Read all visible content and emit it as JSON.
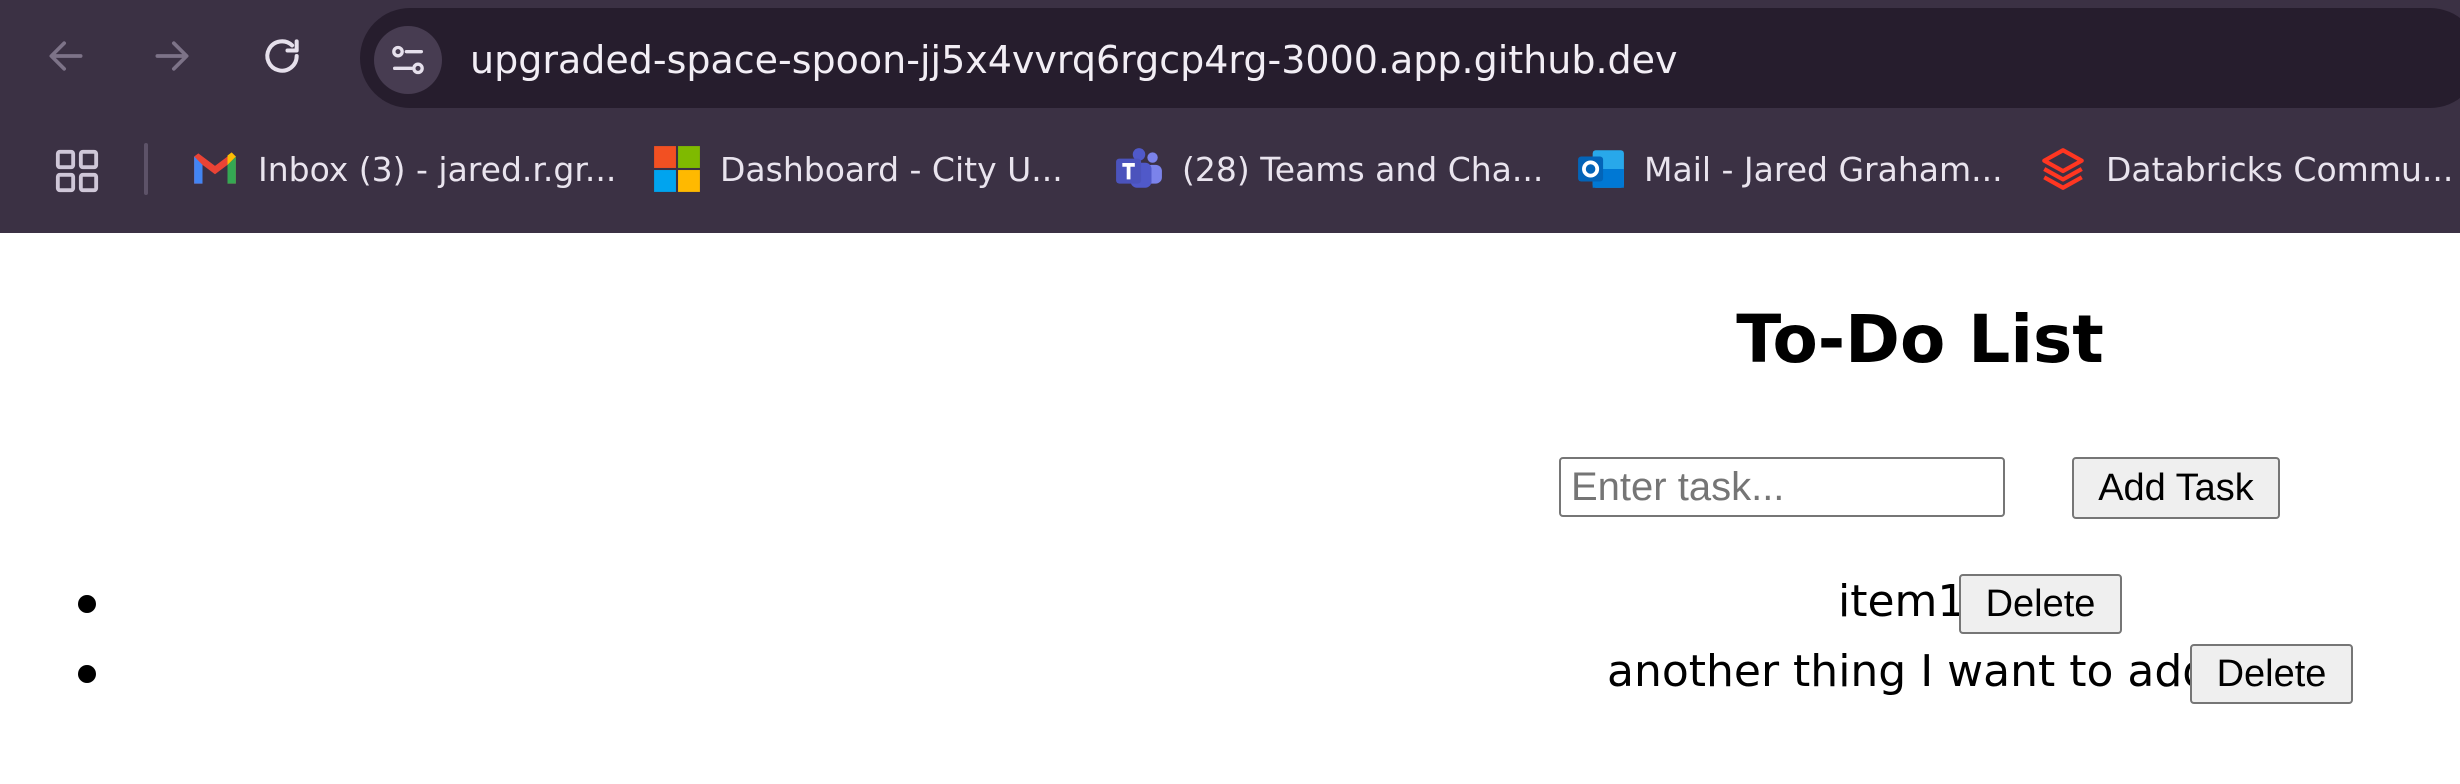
{
  "browser": {
    "url": "upgraded-space-spoon-jj5x4vvrq6rgcp4rg-3000.app.github.dev",
    "bookmarks": [
      {
        "label": "Inbox (3) - jared.r.gr...",
        "icon": "gmail-icon"
      },
      {
        "label": "Dashboard - City U...",
        "icon": "microsoft-icon"
      },
      {
        "label": "(28) Teams and Cha...",
        "icon": "teams-icon"
      },
      {
        "label": "Mail - Jared Graham...",
        "icon": "outlook-icon"
      },
      {
        "label": "Databricks Commu...",
        "icon": "databricks-icon"
      }
    ]
  },
  "app": {
    "title": "To-Do List",
    "input_placeholder": "Enter task...",
    "input_value": "",
    "add_button_label": "Add Task",
    "tasks": [
      {
        "text": "item1",
        "delete_label": "Delete"
      },
      {
        "text": "another thing I want to add",
        "delete_label": "Delete"
      }
    ]
  },
  "colors": {
    "chrome_bg": "#3b3144",
    "omnibox_bg": "#261d2d",
    "page_bg": "#ffffff"
  }
}
